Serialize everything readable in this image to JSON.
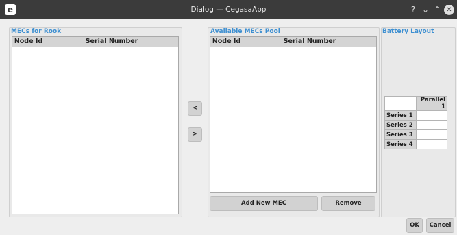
{
  "window": {
    "title": "Dialog — CegasaApp",
    "app_icon_glyph": "e",
    "help_glyph": "?",
    "minimize_glyph": "⌄",
    "maximize_glyph": "⌃",
    "close_glyph": "✕"
  },
  "rook_group": {
    "title": "MECs for Rook",
    "columns": [
      "Node Id",
      "Serial Number"
    ],
    "rows": []
  },
  "transfer": {
    "left_label": "<",
    "right_label": ">"
  },
  "pool_group": {
    "title": "Available MECs Pool",
    "columns": [
      "Node Id",
      "Serial Number"
    ],
    "rows": [],
    "add_label": "Add New MEC",
    "remove_label": "Remove"
  },
  "battery_layout": {
    "title": "Battery Layout",
    "column_header": "Parallel 1",
    "rows": [
      "Series 1",
      "Series 2",
      "Series 3",
      "Series 4"
    ]
  },
  "footer": {
    "ok_label": "OK",
    "cancel_label": "Cancel"
  },
  "colors": {
    "titlebar": "#3b3b3b",
    "group_title": "#3d8fd1",
    "background": "#eeeeee"
  }
}
